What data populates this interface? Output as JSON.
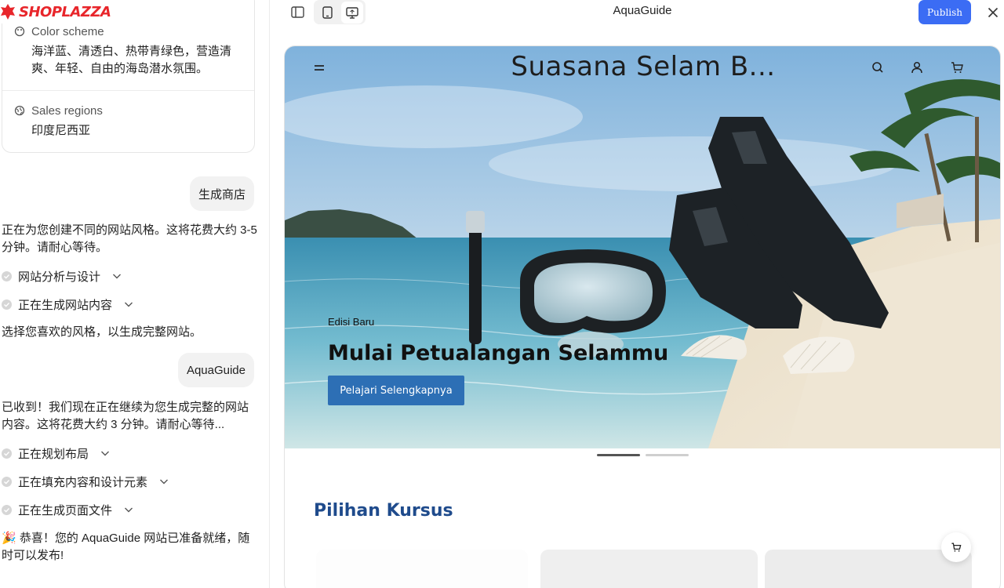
{
  "brand": {
    "name": "SHOPLAZZA",
    "color": "#e8262b"
  },
  "summary_card": {
    "color_scheme_label": "Color scheme",
    "color_scheme_text": "海洋蓝、清透白、热带青绿色，营造清爽、年轻、自由的海岛潜水氛围。",
    "sales_regions_label": "Sales regions",
    "sales_regions_text": "印度尼西亚"
  },
  "chat": {
    "user_msg_1": "生成商店",
    "bot_msg_1": "正在为您创建不同的网站风格。这将花费大约 3-5 分钟。请耐心等待。",
    "steps_1": [
      "网站分析与设计",
      "正在生成网站内容"
    ],
    "bot_msg_2": "选择您喜欢的风格，以生成完整网站。",
    "user_msg_2": "AquaGuide",
    "bot_msg_3": "已收到！我们现在正在继续为您生成完整的网站内容。这将花费大约 3 分钟。请耐心等待...",
    "steps_2": [
      "正在规划布局",
      "正在填充内容和设计元素",
      "正在生成页面文件"
    ],
    "bot_msg_4": "🎉 恭喜！您的 AquaGuide 网站已准备就绪，随时可以发布!"
  },
  "topbar": {
    "title": "AquaGuide",
    "publish_label": "Publish",
    "icons": [
      "sidebar-toggle-icon",
      "mobile-view-icon",
      "desktop-view-icon",
      "close-icon"
    ]
  },
  "preview": {
    "store_title": "Suasana Selam B...",
    "hero_subtitle": "Edisi Baru",
    "hero_title": "Mulai Petualangan Selammu",
    "hero_button": "Pelajari Selengkapnya",
    "section_title": "Pilihan Kursus",
    "accent_color": "#2d6fb5",
    "section_color": "#1f4b8c",
    "nav_icons": [
      "search-icon",
      "account-icon",
      "cart-icon"
    ]
  }
}
